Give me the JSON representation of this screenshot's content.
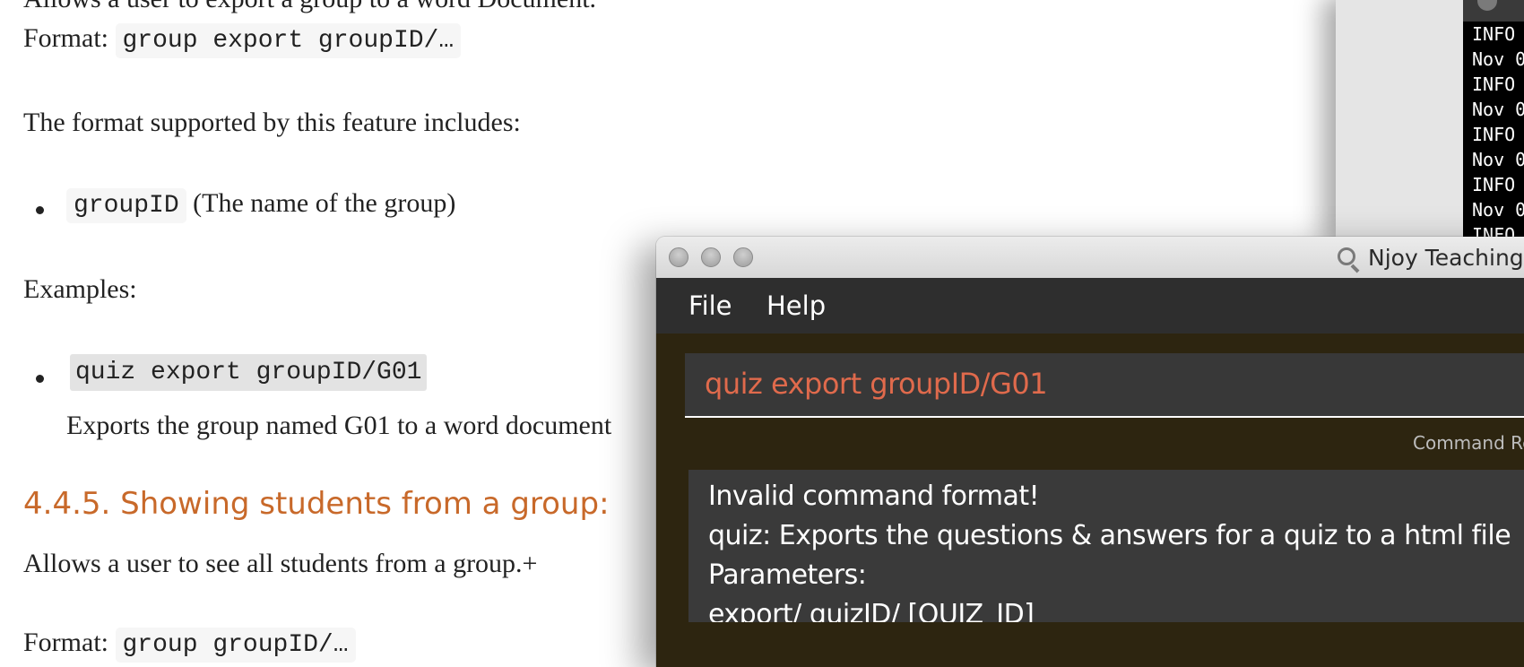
{
  "doc": {
    "intro_text": "Allows a user to export a group to a word Document.",
    "format_label": "Format:",
    "format_code": "group export groupID/…",
    "supported_text": "The format supported by this feature includes:",
    "param_code": "groupID",
    "param_desc": "(The name of the group)",
    "examples_label": "Examples:",
    "example_code": "quiz export groupID/G01",
    "example_desc": "Exports the group named G01 to a word document",
    "section_heading": "4.4.5. Showing students from a group:",
    "section_intro": "Allows a user to see all students from a group.+",
    "section_format_label": "Format:",
    "section_format_code": "group groupID/…"
  },
  "terminal": {
    "lines": [
      "INFO",
      "Nov 0",
      "INFO",
      "Nov 0",
      "INFO",
      "Nov 0",
      "INFO",
      "Nov 0",
      "INFO"
    ]
  },
  "app": {
    "window_title": "Njoy Teaching Assistant",
    "menu": {
      "file": "File",
      "help": "Help"
    },
    "command_input": "quiz export groupID/G01",
    "result_label": "Command Result",
    "result_lines": [
      "Invalid command format!",
      "quiz: Exports the questions & answers for a quiz to a html file",
      "Parameters:",
      "export/ quizID/ [QUIZ_ID]"
    ],
    "colors": {
      "command_text": "#e06a4c",
      "content_bg": "#2d2510",
      "menubar_bg": "#2e2e2e",
      "doc_heading": "#c8692a"
    }
  }
}
